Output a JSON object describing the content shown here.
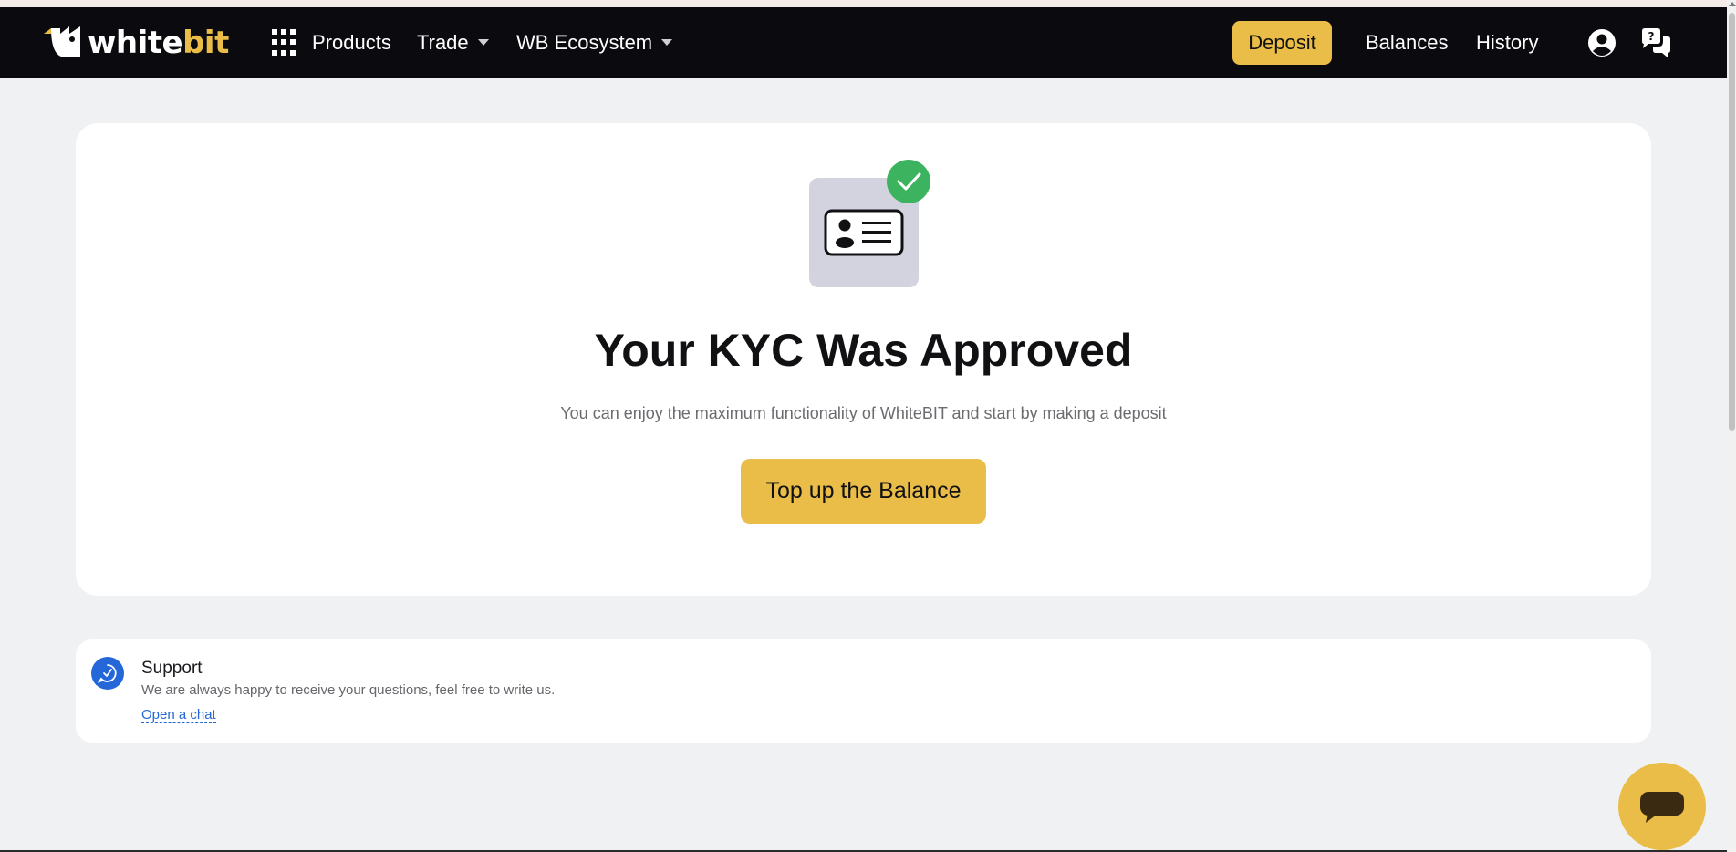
{
  "navbar": {
    "logo": {
      "text_main": "white",
      "text_accent": "bit"
    },
    "products_label": "Products",
    "trade_label": "Trade",
    "ecosystem_label": "WB Ecosystem",
    "deposit_label": "Deposit",
    "balances_label": "Balances",
    "history_label": "History",
    "icons": [
      "grid-icon",
      "caret-down-icon",
      "profile-icon",
      "help-chat-icon"
    ]
  },
  "kyc": {
    "title": "Your KYC Was Approved",
    "description": "You can enjoy the maximum functionality of WhiteBIT and start by making a deposit",
    "cta_label": "Top up the Balance",
    "icons": [
      "id-card-icon",
      "check-badge-icon"
    ]
  },
  "support": {
    "title": "Support",
    "description": "We are always happy to receive your questions, feel free to write us.",
    "link_label": "Open a chat",
    "icon": "support-chat-icon"
  },
  "colors": {
    "accent": "#e9bd47",
    "navbar_bg": "#0b0b0f",
    "page_bg": "#f0f1f3",
    "success": "#3cb35f",
    "link": "#2467d9"
  }
}
